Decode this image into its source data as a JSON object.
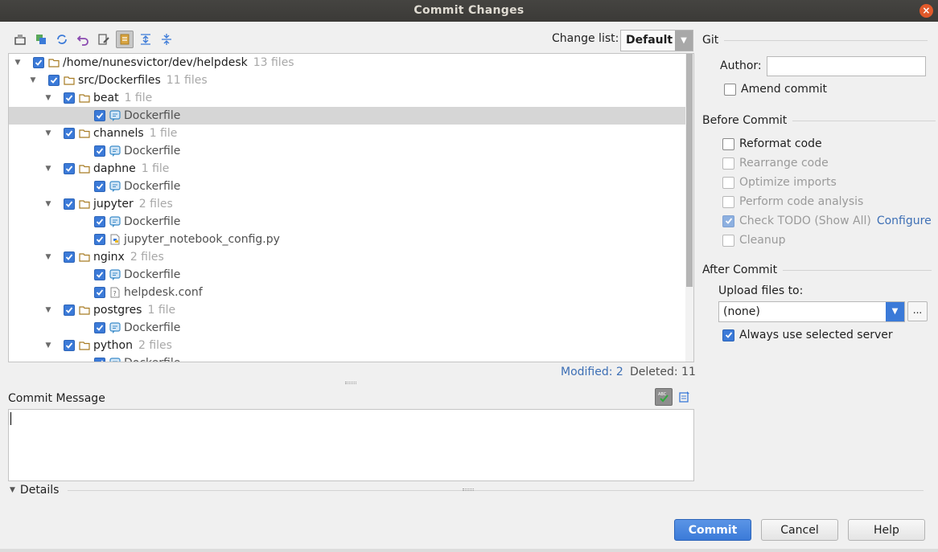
{
  "window": {
    "title": "Commit Changes",
    "close": "×"
  },
  "changelist": {
    "label": "Change list:",
    "value": "Default"
  },
  "tree": [
    {
      "label": "/home/nunesvictor/dev/helpdesk",
      "count": "13 files",
      "kind": "folder",
      "level": 0
    },
    {
      "label": "src/Dockerfiles",
      "count": "11 files",
      "kind": "folder",
      "level": 1
    },
    {
      "label": "beat",
      "count": "1 file",
      "kind": "folder",
      "level": 2
    },
    {
      "label": "Dockerfile",
      "count": "",
      "kind": "docker",
      "level": 3,
      "selected": true
    },
    {
      "label": "channels",
      "count": "1 file",
      "kind": "folder",
      "level": 2
    },
    {
      "label": "Dockerfile",
      "count": "",
      "kind": "docker",
      "level": 3
    },
    {
      "label": "daphne",
      "count": "1 file",
      "kind": "folder",
      "level": 2
    },
    {
      "label": "Dockerfile",
      "count": "",
      "kind": "docker",
      "level": 3
    },
    {
      "label": "jupyter",
      "count": "2 files",
      "kind": "folder",
      "level": 2
    },
    {
      "label": "Dockerfile",
      "count": "",
      "kind": "docker",
      "level": 3
    },
    {
      "label": "jupyter_notebook_config.py",
      "count": "",
      "kind": "python",
      "level": 3
    },
    {
      "label": "nginx",
      "count": "2 files",
      "kind": "folder",
      "level": 2
    },
    {
      "label": "Dockerfile",
      "count": "",
      "kind": "docker",
      "level": 3
    },
    {
      "label": "helpdesk.conf",
      "count": "",
      "kind": "unknown",
      "level": 3
    },
    {
      "label": "postgres",
      "count": "1 file",
      "kind": "folder",
      "level": 2
    },
    {
      "label": "Dockerfile",
      "count": "",
      "kind": "docker",
      "level": 3
    },
    {
      "label": "python",
      "count": "2 files",
      "kind": "folder",
      "level": 2
    },
    {
      "label": "Dockerfile",
      "count": "",
      "kind": "docker",
      "level": 3
    }
  ],
  "status": {
    "modified": "Modified: 2",
    "deleted": "Deleted: 11"
  },
  "commit_message": {
    "label": "Commit Message",
    "value": ""
  },
  "details": {
    "label": "Details"
  },
  "git": {
    "section": "Git",
    "author_label": "Author:",
    "author_value": "",
    "amend": "Amend commit"
  },
  "before_commit": {
    "section": "Before Commit",
    "reformat": "Reformat code",
    "rearrange": "Rearrange code",
    "optimize": "Optimize imports",
    "analysis": "Perform code analysis",
    "todo": "Check TODO (Show All)",
    "configure": "Configure",
    "cleanup": "Cleanup"
  },
  "after_commit": {
    "section": "After Commit",
    "upload_label": "Upload files to:",
    "upload_value": "(none)",
    "more": "...",
    "always": "Always use selected server"
  },
  "buttons": {
    "commit": "Commit",
    "cancel": "Cancel",
    "help": "Help"
  },
  "colors": {
    "accent": "#3b7ad8",
    "link": "#3d6fb5",
    "titlebar": "#3b3a37",
    "close": "#e1592a"
  }
}
